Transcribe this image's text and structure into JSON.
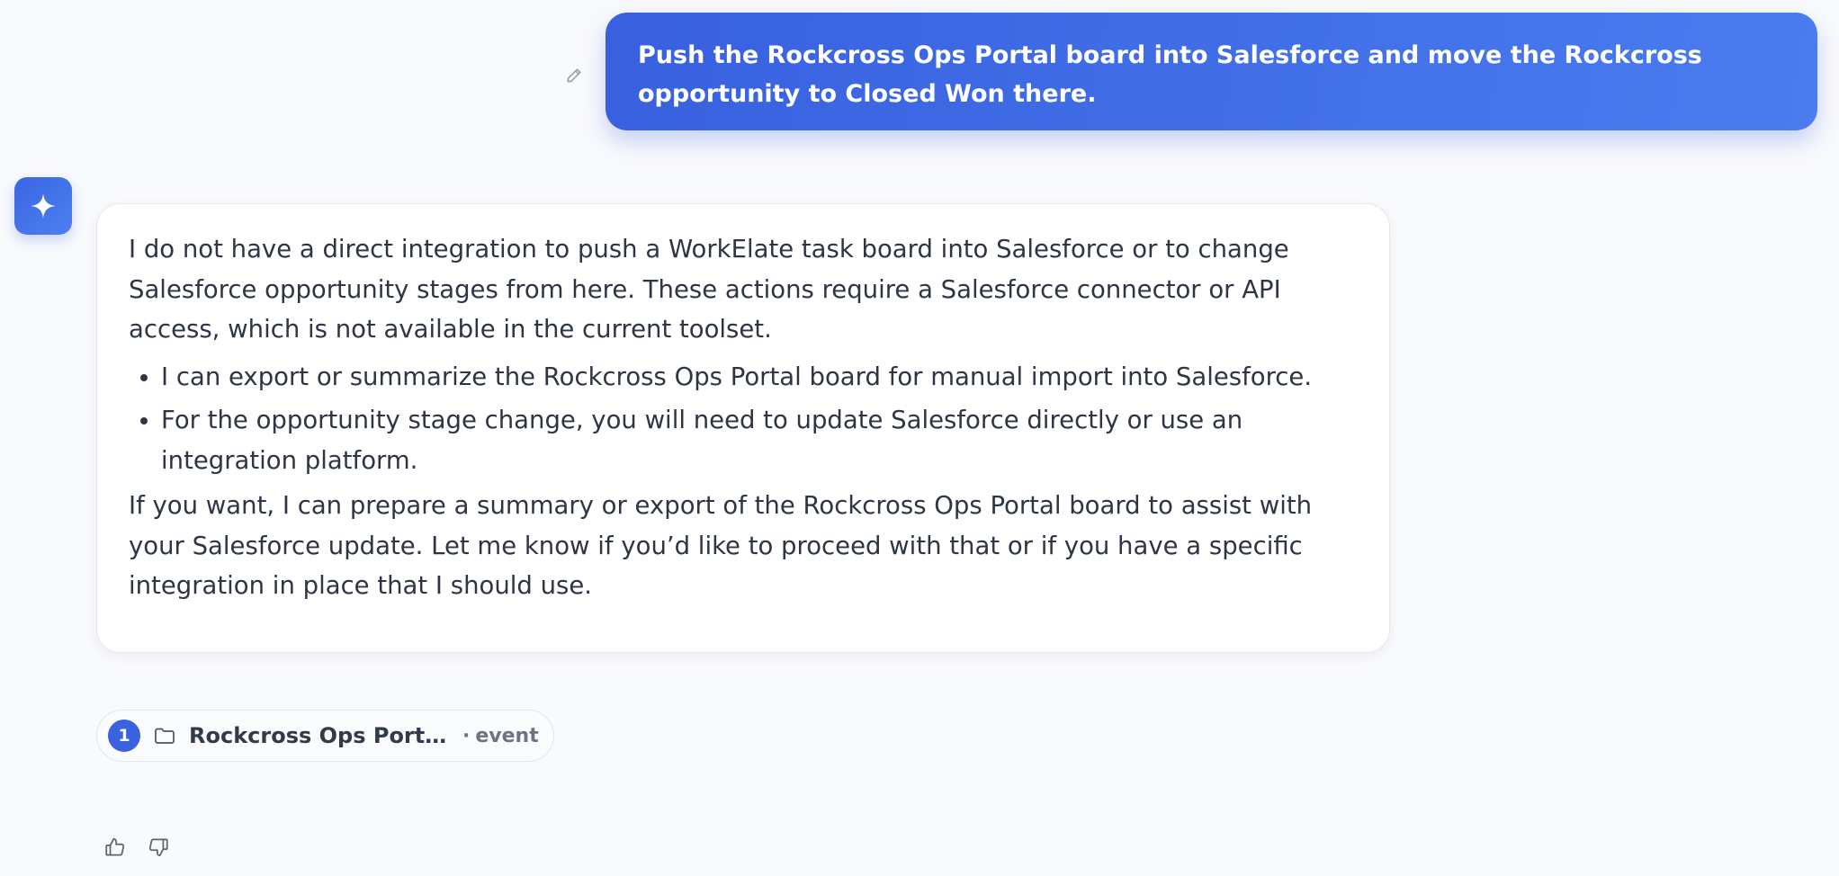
{
  "user_message": {
    "text": "Push the Rockcross Ops Portal board into Salesforce and move the Rockcross opportunity to Closed Won there.",
    "edit_icon": "pencil-icon"
  },
  "assistant": {
    "avatar_icon": "sparkle-icon",
    "paragraph_1": "I do not have a direct integration to push a WorkElate task board into Salesforce or to change Salesforce opportunity stages from here. These actions require a Salesforce connector or API access, which is not available in the current toolset.",
    "bullets": [
      "I can export or summarize the Rockcross Ops Portal board for manual import into Salesforce.",
      "For the opportunity stage change, you will need to update Salesforce directly or use an integration platform."
    ],
    "paragraph_2": "If you want, I can prepare a summary or export of the Rockcross Ops Portal board to assist with your Salesforce update. Let me know if you’d like to proceed with that or if you have a specific integration in place that I should use."
  },
  "source_chip": {
    "index": "1",
    "icon": "folder-icon",
    "title": "Rockcross Ops Portal — ...",
    "separator": "·",
    "type": "event"
  },
  "feedback": {
    "like_icon": "thumbs-up-icon",
    "dislike_icon": "thumbs-down-icon"
  },
  "colors": {
    "accent": "#3b63e0",
    "user_bubble_start": "#3860df",
    "user_bubble_end": "#4a7cef",
    "background": "#f9fafc"
  }
}
